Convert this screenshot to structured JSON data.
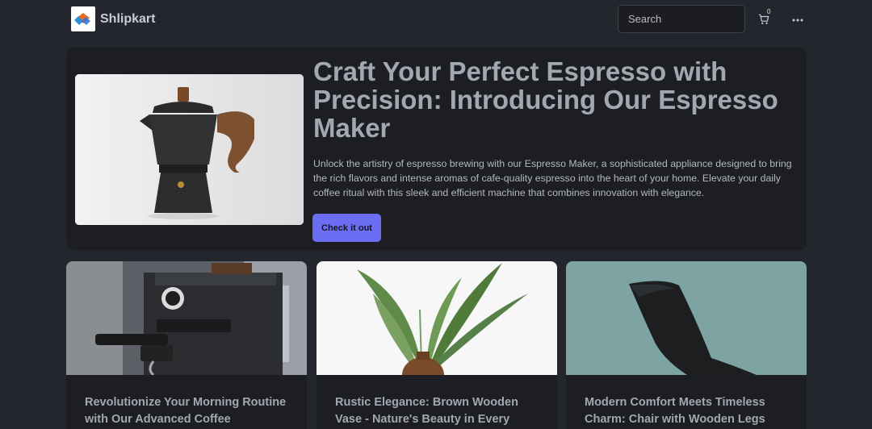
{
  "navbar": {
    "brand_name": "Shlipkart",
    "search_placeholder": "Search",
    "cart_count": "0"
  },
  "hero": {
    "title": "Craft Your Perfect Espresso with Precision: Introducing Our Espresso Maker",
    "description": "Unlock the artistry of espresso brewing with our Espresso Maker, a sophisticated appliance designed to bring the rich flavors and intense aromas of cafe-quality espresso into the heart of your home. Elevate your daily coffee ritual with this sleek and efficient machine that combines innovation with elegance.",
    "button_label": "Check it out"
  },
  "products": [
    {
      "title": "Revolutionize Your Morning Routine with Our Advanced Coffee"
    },
    {
      "title": "Rustic Elegance: Brown Wooden Vase - Nature's Beauty in Every"
    },
    {
      "title": "Modern Comfort Meets Timeless Charm: Chair with Wooden Legs"
    }
  ],
  "colors": {
    "background": "#23262d",
    "panel": "#1c1e23",
    "accent": "#6b6df2",
    "heading": "#a3a7b0"
  },
  "icons": [
    "logo-icon",
    "cart-icon",
    "more-icon"
  ]
}
